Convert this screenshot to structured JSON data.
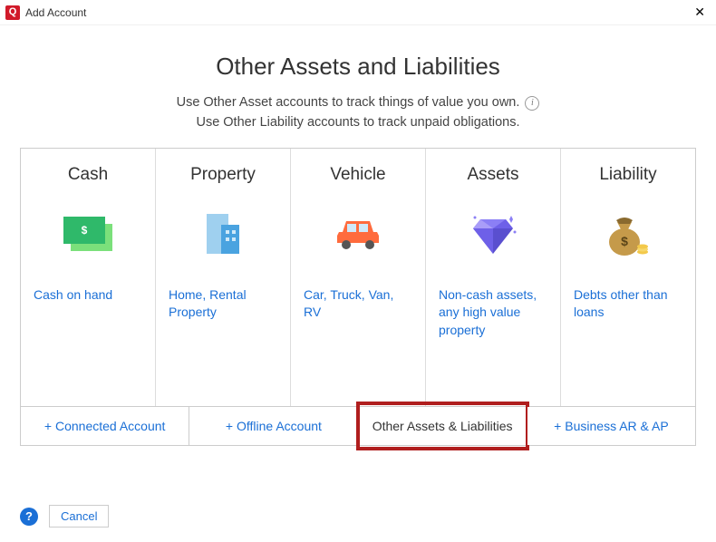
{
  "window": {
    "title": "Add Account",
    "app_letter": "Q"
  },
  "page_title": "Other Assets and Liabilities",
  "subtitle_line1": "Use Other Asset accounts to track things of value you own.",
  "subtitle_line2": "Use Other Liability accounts to track unpaid obligations.",
  "cards": [
    {
      "title": "Cash",
      "link": "Cash on hand"
    },
    {
      "title": "Property",
      "link": "Home, Rental Property"
    },
    {
      "title": "Vehicle",
      "link": "Car, Truck, Van, RV"
    },
    {
      "title": "Assets",
      "link": "Non-cash assets, any high value property"
    },
    {
      "title": "Liability",
      "link": "Debts other than loans"
    }
  ],
  "tabs": {
    "connected": "Connected Account",
    "offline": "Offline Account",
    "other": "Other Assets & Liabilities",
    "business": "Business AR & AP"
  },
  "footer": {
    "cancel": "Cancel"
  }
}
